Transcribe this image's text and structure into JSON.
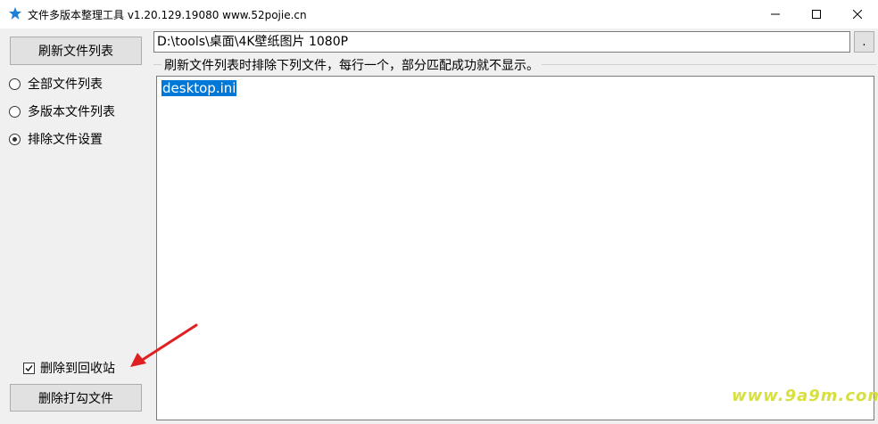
{
  "window": {
    "title": "文件多版本整理工具 v1.20.129.19080 www.52pojie.cn",
    "icon": "star-icon",
    "accent": "#1e7fd6"
  },
  "left": {
    "refresh_button": "刷新文件列表",
    "radios": [
      {
        "label": "全部文件列表",
        "checked": false
      },
      {
        "label": "多版本文件列表",
        "checked": false
      },
      {
        "label": "排除文件设置",
        "checked": true
      }
    ],
    "recycle_checkbox": {
      "label": "删除到回收站",
      "checked": true
    },
    "delete_button": "删除打勾文件"
  },
  "main": {
    "path_value": "D:\\tools\\桌面\\4K壁纸图片 1080P",
    "browse_button": ".",
    "group_label": "刷新文件列表时排除下列文件，每行一个，部分匹配成功就不显示。",
    "exclude_lines": [
      "desktop.ini"
    ],
    "selection_color": "#0078d7"
  },
  "watermark": "www.9a9m.com"
}
